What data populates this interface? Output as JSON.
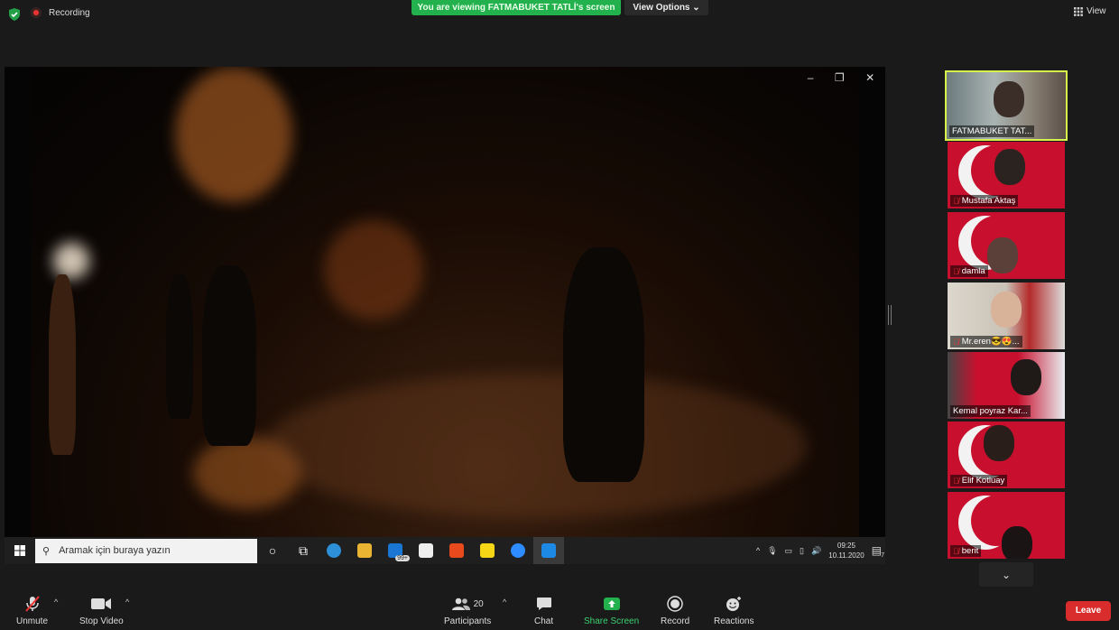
{
  "topbar": {
    "recording_label": "Recording",
    "viewing_banner": "You are viewing FATMABUKET TATLİ's screen",
    "view_options": "View Options ⌄",
    "view_button": "View"
  },
  "shared_screen": {
    "window_controls": [
      "–",
      "❐",
      "✕"
    ],
    "taskbar": {
      "search_placeholder": "Aramak için buraya yazın",
      "mail_badge": "99+",
      "time": "09:25",
      "date": "10.11.2020",
      "notif_count": "7"
    }
  },
  "gallery": [
    {
      "name": "FATMABUKET TAT...",
      "active": true,
      "muted": false
    },
    {
      "name": "Mustafa Aktaş",
      "muted": true
    },
    {
      "name": "damla",
      "muted": true
    },
    {
      "name": "Mr.eren😎😍...",
      "muted": true
    },
    {
      "name": "Kemal poyraz Kar...",
      "muted": false
    },
    {
      "name": "Elif Kotluay",
      "muted": true
    },
    {
      "name": "berit",
      "muted": true
    }
  ],
  "toolbar": {
    "unmute": "Unmute",
    "stop_video": "Stop Video",
    "participants": "Participants",
    "participants_count": "20",
    "chat": "Chat",
    "share_screen": "Share Screen",
    "record": "Record",
    "reactions": "Reactions",
    "leave": "Leave"
  },
  "colors": {
    "share_green": "#22b14c",
    "active_speaker": "#d6f24b",
    "leave_red": "#d92c2c"
  }
}
